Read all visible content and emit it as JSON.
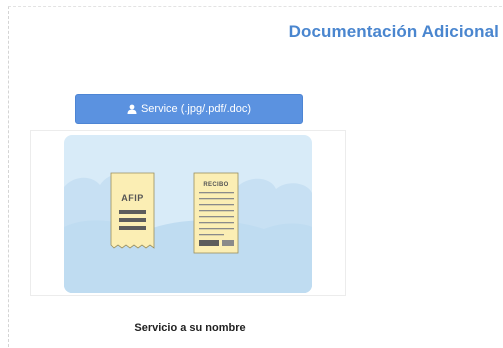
{
  "section": {
    "title": "Documentación Adicional"
  },
  "upload": {
    "button_label": "Service (.jpg/.pdf/.doc)",
    "icon": "user-icon"
  },
  "preview": {
    "afip_label": "AFIP",
    "recibo_label": "RECIBO",
    "caption": "Servicio a su nombre"
  },
  "colors": {
    "title": "#4a86cf",
    "button": "#5b92e0",
    "card_background": "#d8ebf8",
    "document_fill": "#fbeeb4",
    "document_lines": "#5c5c5c"
  }
}
